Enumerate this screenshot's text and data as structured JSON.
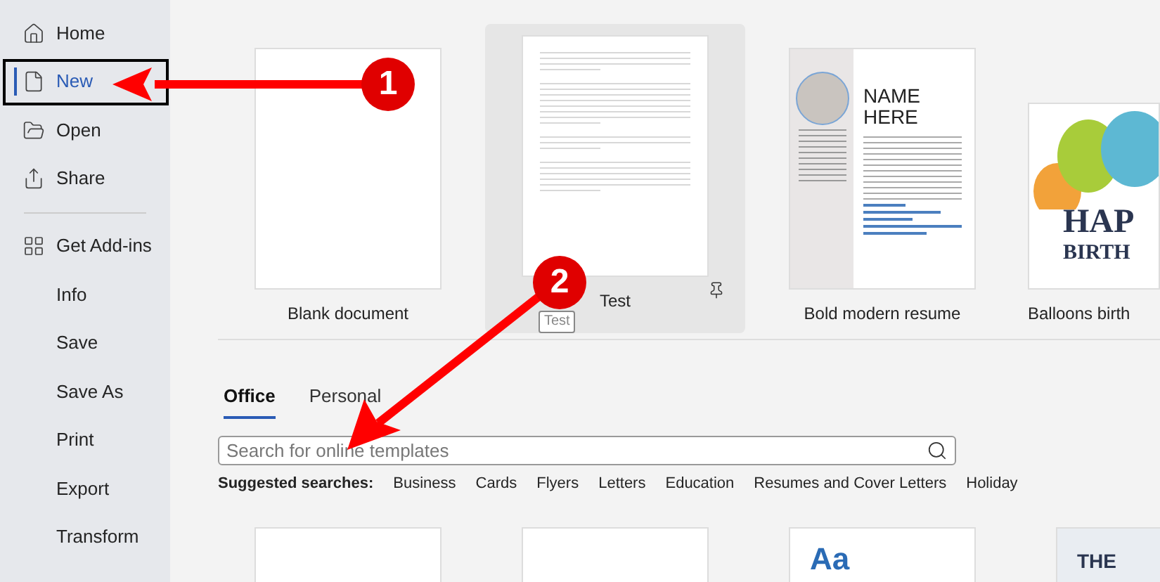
{
  "sidebar": {
    "groups": [
      [
        {
          "label": "Home",
          "selected": false
        },
        {
          "label": "New",
          "selected": true
        },
        {
          "label": "Open",
          "selected": false
        },
        {
          "label": "Share",
          "selected": false
        }
      ],
      [
        {
          "label": "Get Add-ins",
          "selected": false
        },
        {
          "label": "Info",
          "selected": false
        },
        {
          "label": "Save",
          "selected": false
        },
        {
          "label": "Save As",
          "selected": false
        },
        {
          "label": "Print",
          "selected": false
        },
        {
          "label": "Export",
          "selected": false
        },
        {
          "label": "Transform",
          "selected": false
        }
      ]
    ]
  },
  "templates": [
    {
      "kind": "blank",
      "label": "Blank document",
      "selected": false
    },
    {
      "kind": "document",
      "label": "Test",
      "selected": true,
      "tooltip": "Test"
    },
    {
      "kind": "resume",
      "label": "Bold modern resume",
      "selected": false,
      "preview_lines": [
        "NAME",
        "HERE"
      ]
    },
    {
      "kind": "balloons",
      "label": "Balloons birth",
      "selected": false,
      "preview_lines": [
        "HAP",
        "BIRTH"
      ]
    }
  ],
  "tabs": [
    {
      "label": "Office",
      "selected": true
    },
    {
      "label": "Personal",
      "selected": false
    }
  ],
  "search": {
    "placeholder": "Search for online templates"
  },
  "suggested": {
    "label": "Suggested searches:",
    "items": [
      "Business",
      "Cards",
      "Flyers",
      "Letters",
      "Education",
      "Resumes and Cover Letters",
      "Holiday"
    ]
  },
  "more_templates": [
    {
      "kind": "blank"
    },
    {
      "kind": "blank"
    },
    {
      "kind": "theme",
      "text": "Aa"
    },
    {
      "kind": "title",
      "text": "THE"
    }
  ],
  "annotations": [
    {
      "number": "1"
    },
    {
      "number": "2"
    }
  ]
}
